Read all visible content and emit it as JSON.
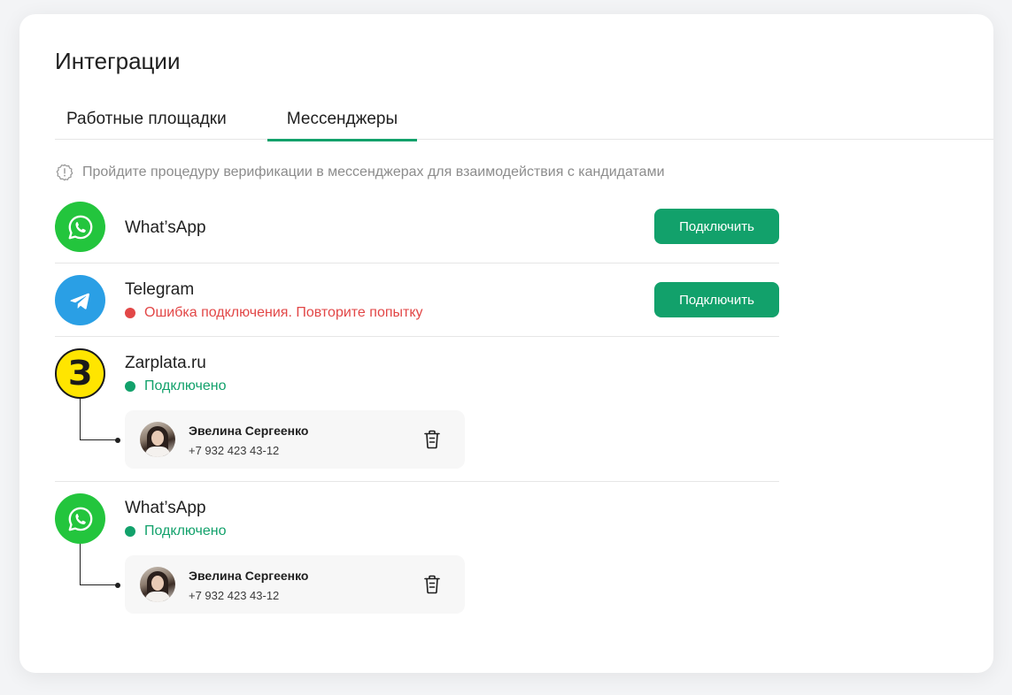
{
  "page": {
    "title": "Интеграции",
    "tabs": [
      {
        "label": "Работные площадки",
        "active": false
      },
      {
        "label": "Мессенджеры",
        "active": true
      }
    ],
    "notice": {
      "icon": "alert-badge-icon",
      "text": "Пройдите процедуру верификации в мессенджерах для взаимодействия с кандидатами"
    }
  },
  "integrations": [
    {
      "name": "What’sApp",
      "icon": "whatsapp-icon",
      "button": "Подключить"
    },
    {
      "name": "Telegram",
      "icon": "telegram-icon",
      "status": "Ошибка подключения. Повторите попытку",
      "status_type": "error",
      "button": "Подключить"
    },
    {
      "name": "Zarplata.ru",
      "icon": "zarplata-logo",
      "logo_letter": "З",
      "status": "Подключено",
      "status_type": "ok",
      "contact": {
        "name": "Эвелина Сергеенко",
        "phone": "+7 932 423 43-12"
      }
    },
    {
      "name": "What’sApp",
      "icon": "whatsapp-icon",
      "status": "Подключено",
      "status_type": "ok",
      "contact": {
        "name": "Эвелина Сергеенко",
        "phone": "+7 932 423 43-12"
      }
    }
  ],
  "colors": {
    "accent": "#12a16b",
    "error": "#e24747",
    "whatsapp": "#23c53d",
    "telegram": "#2a9fe5",
    "zarplata": "#ffe500"
  }
}
